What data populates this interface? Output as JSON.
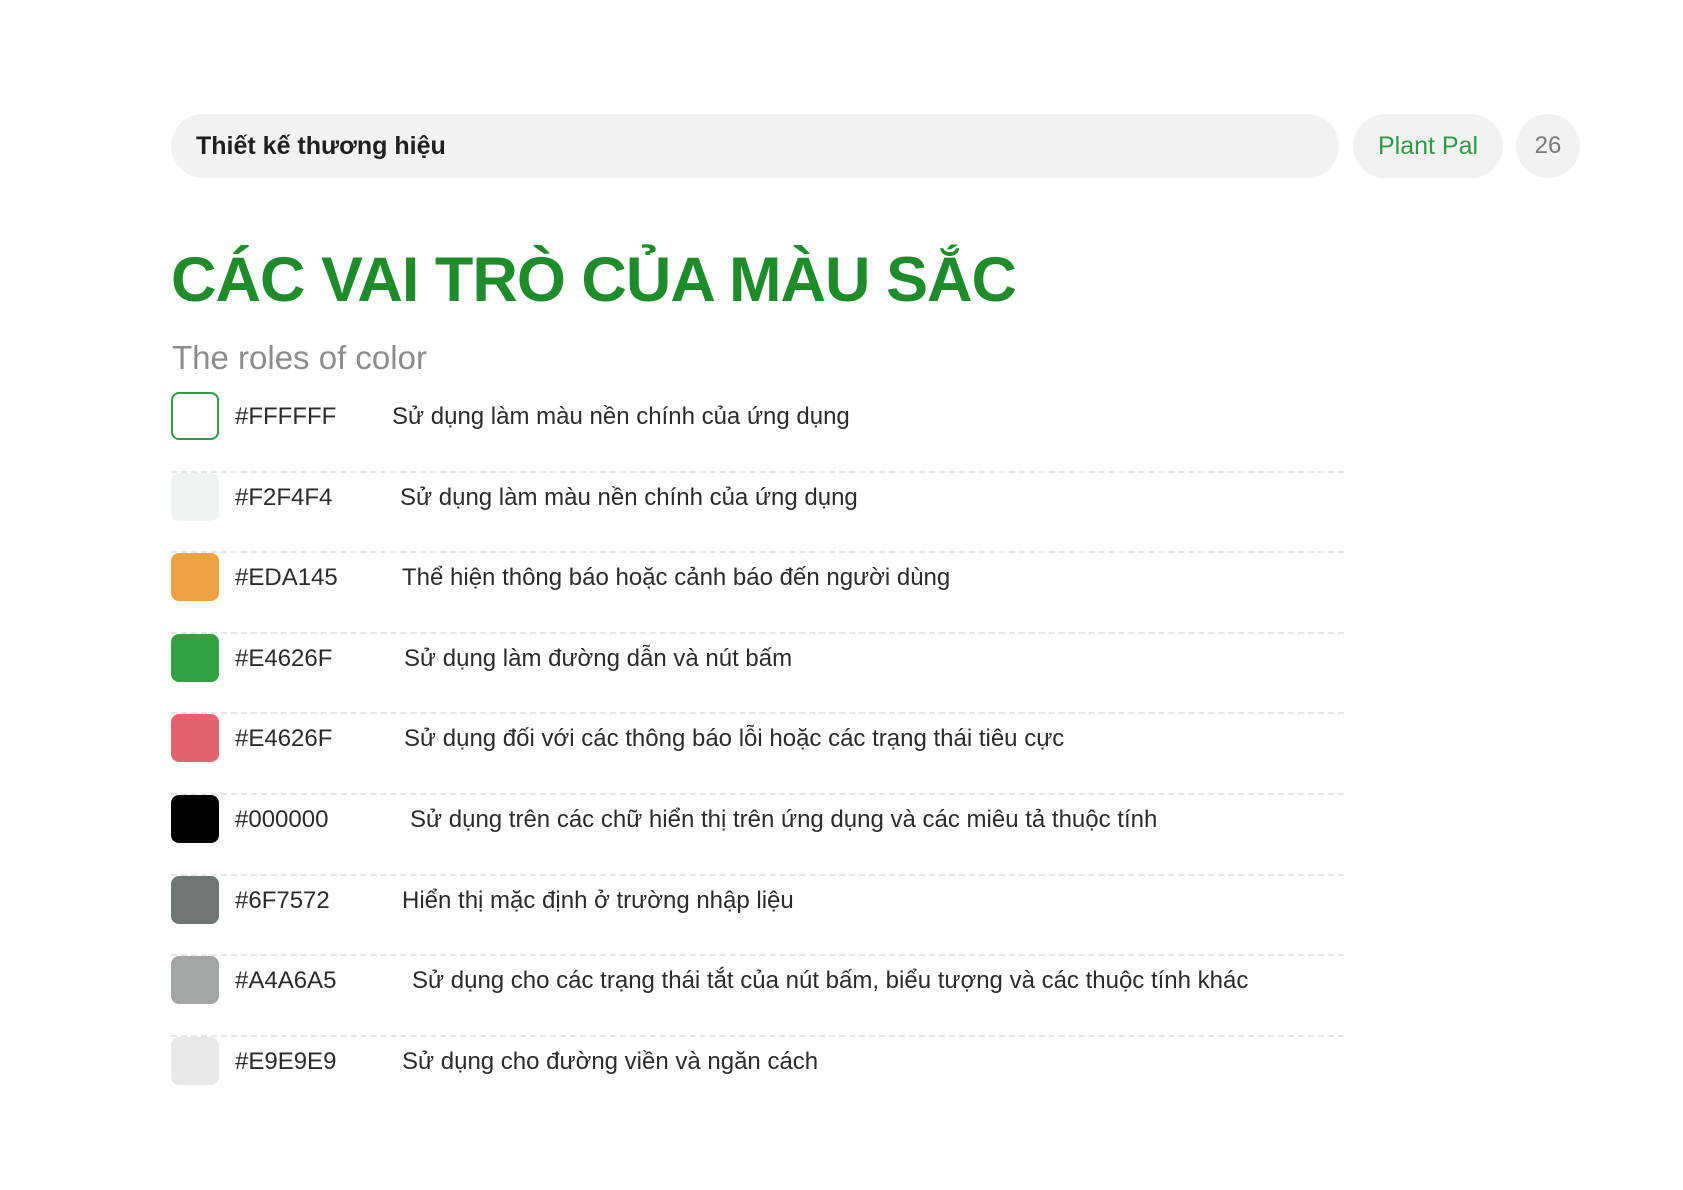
{
  "header": {
    "section_label": "Thiết kế thương hiệu",
    "brand": "Plant Pal",
    "page_number": "26"
  },
  "title": "CÁC VAI TRÒ CỦA MÀU SẮC",
  "subtitle": "The roles of color",
  "colors": [
    {
      "hex_label": "#FFFFFF",
      "description": "Sử dụng làm màu nền chính của ứng dụng",
      "swatch": "#FFFFFF",
      "border": "#2e9a43"
    },
    {
      "hex_label": "#F2F4F4",
      "description": "Sử dụng làm màu nền chính của ứng dụng",
      "swatch": "#F2F4F4"
    },
    {
      "hex_label": "#EDA145",
      "description": "Thể hiện thông báo hoặc cảnh báo đến người dùng",
      "swatch": "#EDA145"
    },
    {
      "hex_label": "#E4626F",
      "description": "Sử dụng làm đường dẫn và nút bấm",
      "swatch": "#33A043"
    },
    {
      "hex_label": "#E4626F",
      "description": "Sử dụng đối với các thông báo lỗi hoặc các trạng thái tiêu cực",
      "swatch": "#E4626F"
    },
    {
      "hex_label": "#000000",
      "description": "Sử dụng trên các chữ hiển thị trên ứng dụng và các miêu tả thuộc tính",
      "swatch": "#000000"
    },
    {
      "hex_label": "#6F7572",
      "description": "Hiển thị mặc định ở trường nhập liệu",
      "swatch": "#6F7572"
    },
    {
      "hex_label": "#A4A6A5",
      "description": "Sử dụng cho các trạng thái tắt của nút bấm, biểu tượng và các thuộc tính khác",
      "swatch": "#A4A6A5"
    },
    {
      "hex_label": "#E9E9E9",
      "description": "Sử dụng cho đường viền và ngăn cách",
      "swatch": "#E9E9E9"
    }
  ]
}
